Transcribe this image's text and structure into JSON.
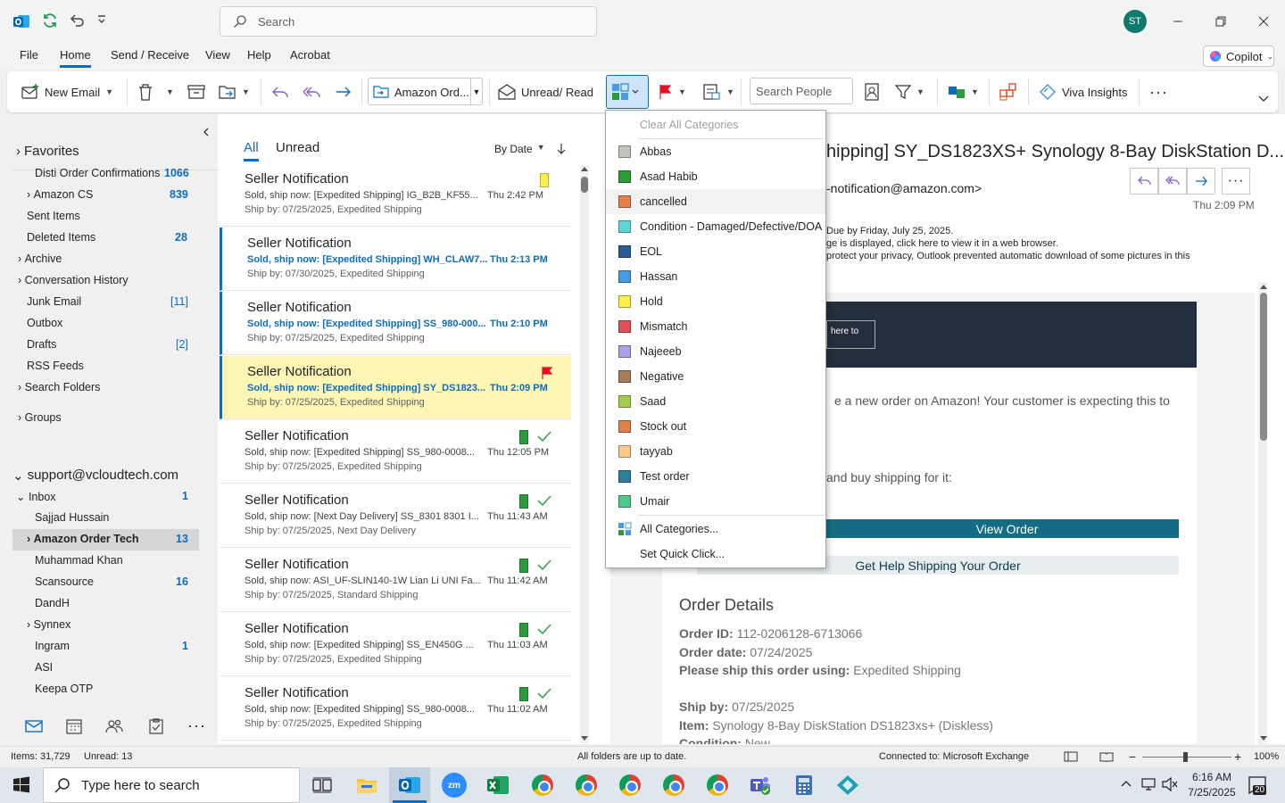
{
  "titlebar": {
    "search_placeholder": "Search",
    "avatar_initials": "ST"
  },
  "menu": [
    "File",
    "Home",
    "Send / Receive",
    "View",
    "Help",
    "Acrobat"
  ],
  "copilot": "Copilot",
  "ribbon": {
    "new_email": "New Email",
    "quick_step": "Amazon Ord...",
    "unread_read": "Unread/ Read",
    "search_people": "Search People",
    "viva": "Viva Insights"
  },
  "nav": {
    "favorites": "Favorites",
    "fav_items": [
      {
        "label": "Disti Order Confirmations",
        "count": "1066"
      },
      {
        "label": "Amazon CS",
        "count": "839"
      },
      {
        "label": "Sent Items",
        "count": ""
      },
      {
        "label": "Deleted Items",
        "count": "28"
      },
      {
        "label": "Archive",
        "count": ""
      },
      {
        "label": "Conversation History",
        "count": ""
      },
      {
        "label": "Junk Email",
        "count": "[11]"
      },
      {
        "label": "Outbox",
        "count": ""
      },
      {
        "label": "Drafts",
        "count": "[2]"
      },
      {
        "label": "RSS Feeds",
        "count": ""
      },
      {
        "label": "Search Folders",
        "count": ""
      }
    ],
    "groups": "Groups",
    "account": "support@vcloudtech.com",
    "inbox": {
      "label": "Inbox",
      "count": "1"
    },
    "subfolders": [
      {
        "label": "Sajjad Hussain",
        "count": ""
      },
      {
        "label": "Amazon Order Tech",
        "count": "13"
      },
      {
        "label": "Muhammad Khan",
        "count": ""
      },
      {
        "label": "Scansource",
        "count": "16"
      },
      {
        "label": "DandH",
        "count": ""
      },
      {
        "label": "Synnex",
        "count": ""
      },
      {
        "label": "Ingram",
        "count": "1"
      },
      {
        "label": "ASI",
        "count": ""
      },
      {
        "label": "Keepa OTP",
        "count": ""
      }
    ]
  },
  "list": {
    "tab_all": "All",
    "tab_unread": "Unread",
    "sort": "By Date",
    "messages": [
      {
        "from": "Seller Notification",
        "subject": "Sold, ship now: [Expedited Shipping] IG_B2B_KF55...",
        "date": "Thu 2:42 PM",
        "ship": "Ship by: 07/25/2025, Expedited Shipping",
        "category": "Hold"
      },
      {
        "from": "Seller Notification",
        "subject": "Sold, ship now: [Expedited Shipping] WH_CLAW7...",
        "date": "Thu 2:13 PM",
        "ship": "Ship by: 07/30/2025, Expedited Shipping",
        "category": ""
      },
      {
        "from": "Seller Notification",
        "subject": "Sold, ship now: [Expedited Shipping] SS_980-000...",
        "date": "Thu 2:10 PM",
        "ship": "Ship by: 07/25/2025, Expedited Shipping",
        "category": ""
      },
      {
        "from": "Seller Notification",
        "subject": "Sold, ship now: [Expedited Shipping] SY_DS1823...",
        "date": "Thu 2:09 PM",
        "ship": "Ship by: 07/25/2025, Expedited Shipping",
        "category": "flag"
      },
      {
        "from": "Seller Notification",
        "subject": "Sold, ship now: [Expedited Shipping] SS_980-0008...",
        "date": "Thu 12:05 PM",
        "ship": "Ship by: 07/25/2025, Expedited Shipping",
        "category": "Asad Habib"
      },
      {
        "from": "Seller Notification",
        "subject": "Sold, ship now: [Next Day Delivery] SS_8301 8301 I...",
        "date": "Thu 11:43 AM",
        "ship": "Ship by: 07/25/2025, Next Day Delivery",
        "category": "Asad Habib"
      },
      {
        "from": "Seller Notification",
        "subject": "Sold, ship now: ASI_UF-SLIN140-1W Lian Li UNI Fa...",
        "date": "Thu 11:42 AM",
        "ship": "Ship by: 07/25/2025, Standard Shipping",
        "category": "Asad Habib"
      },
      {
        "from": "Seller Notification",
        "subject": "Sold, ship now: [Expedited Shipping] SS_EN450G ...",
        "date": "Thu 11:03 AM",
        "ship": "Ship by: 07/25/2025, Expedited Shipping",
        "category": "Asad Habib"
      },
      {
        "from": "Seller Notification",
        "subject": "Sold, ship now: [Expedited Shipping] SS_980-0008...",
        "date": "Thu 11:02 AM",
        "ship": "Ship by: 07/25/2025, Expedited Shipping",
        "category": "Asad Habib"
      }
    ]
  },
  "reading": {
    "subject": "hipping] SY_DS1823XS+ Synology 8-Bay DiskStation D...",
    "from": "-notification@amazon.com>",
    "time": "Thu 2:09 PM",
    "info1": "Due by Friday, July 25, 2025.",
    "info2": "ge is displayed, click here to view it in a web browser.",
    "info3": "protect your privacy, Outlook prevented automatic download of some pictures in this",
    "header_btn": "here to",
    "line1": "e a new order on Amazon! Your customer is expecting this to",
    "line2": "and buy shipping for it:",
    "view_order": "View Order",
    "get_help": "Get Help Shipping Your Order",
    "order_details": "Order Details",
    "order_id_label": "Order ID:",
    "order_id": "112-0206128-6713066",
    "order_date_label": "Order date:",
    "order_date": "07/24/2025",
    "ship_using_label": "Please ship this order using:",
    "ship_using": "Expedited Shipping",
    "ship_by_label": "Ship by:",
    "ship_by": "07/25/2025",
    "item_label": "Item:",
    "item": "Synology 8-Bay DiskStation DS1823xs+ (Diskless)",
    "condition_label": "Condition:",
    "condition": "New"
  },
  "categories_menu": {
    "clear": "Clear All Categories",
    "items": [
      {
        "label": "Abbas",
        "color": "#c3c3bd"
      },
      {
        "label": "Asad Habib",
        "color": "#2e9a3c"
      },
      {
        "label": "cancelled",
        "color": "#e5804a"
      },
      {
        "label": "Condition - Damaged/Defective/DOA",
        "color": "#5fd6d6"
      },
      {
        "label": "EOL",
        "color": "#2d5c95"
      },
      {
        "label": "Hassan",
        "color": "#4a9ae0"
      },
      {
        "label": "Hold",
        "color": "#fbee4d"
      },
      {
        "label": "Mismatch",
        "color": "#e0505a"
      },
      {
        "label": "Najeeeb",
        "color": "#a9a0e8"
      },
      {
        "label": "Negative",
        "color": "#a97c5a"
      },
      {
        "label": "Saad",
        "color": "#a5cc4a"
      },
      {
        "label": "Stock out",
        "color": "#e0804a"
      },
      {
        "label": "tayyab",
        "color": "#fbc98a"
      },
      {
        "label": "Test order",
        "color": "#2d7f9a"
      },
      {
        "label": "Umair",
        "color": "#4ec98a"
      }
    ],
    "all": "All Categories...",
    "quick": "Set Quick Click..."
  },
  "status": {
    "items": "Items: 31,729",
    "unread": "Unread: 13",
    "sync": "All folders are up to date.",
    "connection": "Connected to: Microsoft Exchange",
    "zoom": "100%"
  },
  "taskbar": {
    "search": "Type here to search",
    "time": "6:16 AM",
    "date": "7/25/2025",
    "notif": "20"
  }
}
